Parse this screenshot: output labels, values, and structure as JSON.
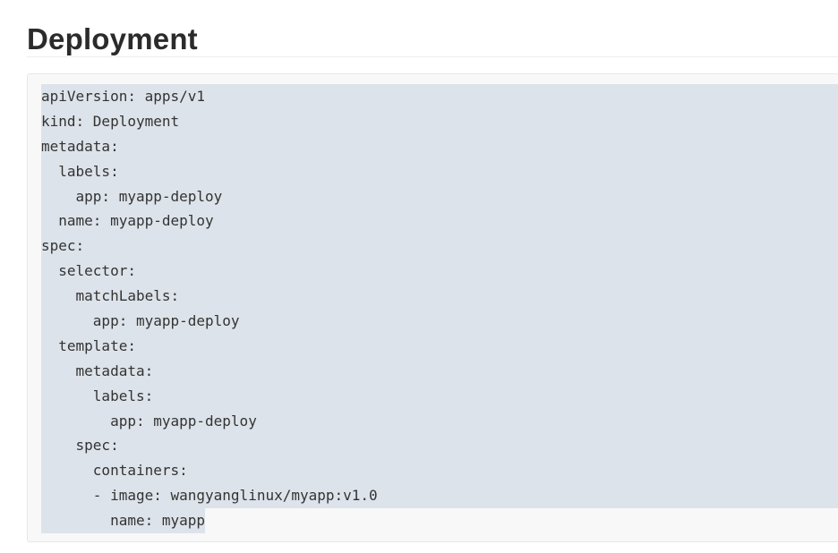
{
  "heading": {
    "title": "Deployment"
  },
  "code": {
    "language": "yaml",
    "selected": true,
    "lines": [
      "apiVersion: apps/v1",
      "kind: Deployment",
      "metadata:",
      "  labels:",
      "    app: myapp-deploy",
      "  name: myapp-deploy",
      "spec:",
      "  selector:",
      "    matchLabels:",
      "      app: myapp-deploy",
      "  template:",
      "    metadata:",
      "      labels:",
      "        app: myapp-deploy",
      "    spec:",
      "      containers:",
      "      - image: wangyanglinux/myapp:v1.0",
      "        name: myapp"
    ]
  },
  "colors": {
    "selection": "#dde3ea",
    "code_background": "#f8f8f8",
    "text": "#333333",
    "heading": "#2b2b2b"
  }
}
